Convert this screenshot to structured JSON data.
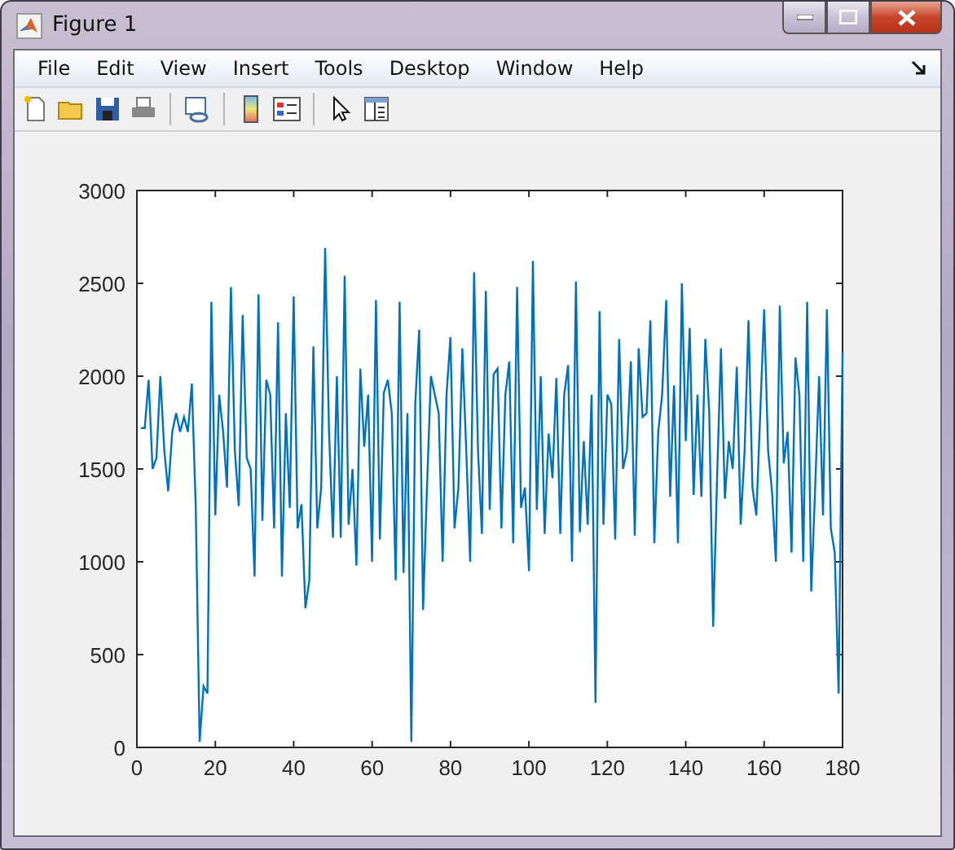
{
  "window": {
    "title": "Figure 1"
  },
  "menu": [
    "File",
    "Edit",
    "View",
    "Insert",
    "Tools",
    "Desktop",
    "Window",
    "Help"
  ],
  "axes": {
    "chart_data": {
      "type": "line",
      "xlim": [
        0,
        180
      ],
      "ylim": [
        0,
        3000
      ],
      "xticks": [
        0,
        20,
        40,
        60,
        80,
        100,
        120,
        140,
        160,
        180
      ],
      "yticks": [
        0,
        500,
        1000,
        1500,
        2000,
        2500,
        3000
      ],
      "x": [
        1,
        2,
        3,
        4,
        5,
        6,
        7,
        8,
        9,
        10,
        11,
        12,
        13,
        14,
        15,
        16,
        17,
        18,
        19,
        20,
        21,
        22,
        23,
        24,
        25,
        26,
        27,
        28,
        29,
        30,
        31,
        32,
        33,
        34,
        35,
        36,
        37,
        38,
        39,
        40,
        41,
        42,
        43,
        44,
        45,
        46,
        47,
        48,
        49,
        50,
        51,
        52,
        53,
        54,
        55,
        56,
        57,
        58,
        59,
        60,
        61,
        62,
        63,
        64,
        65,
        66,
        67,
        68,
        69,
        70,
        71,
        72,
        73,
        74,
        75,
        76,
        77,
        78,
        79,
        80,
        81,
        82,
        83,
        84,
        85,
        86,
        87,
        88,
        89,
        90,
        91,
        92,
        93,
        94,
        95,
        96,
        97,
        98,
        99,
        100,
        101,
        102,
        103,
        104,
        105,
        106,
        107,
        108,
        109,
        110,
        111,
        112,
        113,
        114,
        115,
        116,
        117,
        118,
        119,
        120,
        121,
        122,
        123,
        124,
        125,
        126,
        127,
        128,
        129,
        130,
        131,
        132,
        133,
        134,
        135,
        136,
        137,
        138,
        139,
        140,
        141,
        142,
        143,
        144,
        145,
        146,
        147,
        148,
        149,
        150,
        151,
        152,
        153,
        154,
        155,
        156,
        157,
        158,
        159,
        160,
        161,
        162,
        163,
        164,
        165,
        166,
        167,
        168,
        169,
        170,
        171,
        172,
        173,
        174,
        175,
        176,
        177,
        178,
        179,
        180
      ],
      "series": [
        {
          "color": "#0072bd",
          "values": [
            1720,
            1720,
            1980,
            1500,
            1560,
            2000,
            1600,
            1380,
            1700,
            1800,
            1700,
            1780,
            1700,
            1960,
            1300,
            30,
            330,
            290,
            2400,
            1250,
            1900,
            1700,
            1400,
            2480,
            1600,
            1300,
            2330,
            1560,
            1500,
            920,
            2440,
            1220,
            1980,
            1900,
            1180,
            2290,
            920,
            1800,
            1290,
            2430,
            1180,
            1310,
            750,
            900,
            2160,
            1180,
            1400,
            2690,
            1700,
            1130,
            2000,
            1130,
            2540,
            1200,
            1500,
            980,
            2040,
            1620,
            1900,
            1000,
            2410,
            1120,
            1910,
            1980,
            1800,
            900,
            2400,
            940,
            1800,
            30,
            1850,
            2250,
            740,
            1400,
            2000,
            1900,
            1800,
            1000,
            1900,
            2210,
            1180,
            1400,
            2150,
            1600,
            1000,
            2560,
            1600,
            1150,
            2460,
            1280,
            2010,
            2040,
            1180,
            1900,
            2080,
            1100,
            2480,
            1290,
            1400,
            950,
            2620,
            1280,
            2000,
            1150,
            1690,
            1450,
            1990,
            1150,
            1900,
            2060,
            1000,
            2510,
            1160,
            1650,
            1200,
            1900,
            240,
            2350,
            1200,
            1900,
            1850,
            1120,
            2200,
            1500,
            1600,
            2080,
            1140,
            2150,
            1780,
            1800,
            2300,
            1100,
            1700,
            1900,
            2410,
            1350,
            1950,
            1100,
            2500,
            1650,
            2260,
            1360,
            1900,
            1350,
            2200,
            1800,
            650,
            1450,
            2150,
            1340,
            1650,
            1500,
            2050,
            1200,
            1600,
            2300,
            1400,
            1250,
            1800,
            2360,
            1600,
            1380,
            1000,
            2380,
            1530,
            1700,
            1050,
            2100,
            1900,
            1000,
            2400,
            840,
            1400,
            2000,
            1250,
            2360,
            1180,
            1050,
            290,
            2130
          ]
        }
      ]
    }
  }
}
